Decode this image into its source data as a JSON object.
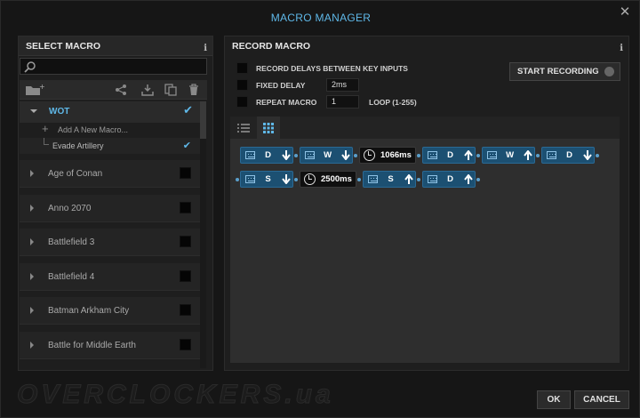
{
  "window": {
    "title": "MACRO MANAGER",
    "close_icon": "close-icon"
  },
  "select_panel": {
    "header": "SELECT MACRO",
    "info": "i",
    "search": {
      "value": "",
      "placeholder": ""
    },
    "toolbar_icons": [
      "new-folder-icon",
      "share-icon",
      "import-icon",
      "duplicate-icon",
      "trash-icon"
    ],
    "active_group": {
      "label": "WOT",
      "checked": true,
      "add_label": "Add A New Macro...",
      "macros": [
        {
          "label": "Evade Artillery",
          "checked": true
        }
      ]
    },
    "groups": [
      {
        "label": "Age of Conan"
      },
      {
        "label": "Anno 2070"
      },
      {
        "label": "Battlefield 3"
      },
      {
        "label": "Battlefield 4"
      },
      {
        "label": "Batman Arkham City"
      },
      {
        "label": "Battle for Middle Earth"
      }
    ]
  },
  "record_panel": {
    "header": "RECORD MACRO",
    "info": "i",
    "options": {
      "record_delays": "RECORD DELAYS BETWEEN KEY INPUTS",
      "fixed_delay": "FIXED DELAY",
      "fixed_delay_value": "2ms",
      "repeat_macro": "REPEAT MACRO",
      "repeat_value": "1",
      "loop_label": "LOOP (1-255)"
    },
    "start_button": "START RECORDING",
    "tabs": [
      "list-view-icon",
      "grid-view-icon"
    ],
    "sequence": [
      {
        "kind": "key",
        "key": "D",
        "dir": "down"
      },
      {
        "kind": "key",
        "key": "W",
        "dir": "down"
      },
      {
        "kind": "delay",
        "text": "1066ms"
      },
      {
        "kind": "key",
        "key": "D",
        "dir": "up"
      },
      {
        "kind": "key",
        "key": "W",
        "dir": "up"
      },
      {
        "kind": "key",
        "key": "D",
        "dir": "down"
      },
      {
        "kind": "key",
        "key": "S",
        "dir": "down"
      },
      {
        "kind": "delay",
        "text": "2500ms"
      },
      {
        "kind": "key",
        "key": "S",
        "dir": "up"
      },
      {
        "kind": "key",
        "key": "D",
        "dir": "up"
      }
    ]
  },
  "footer": {
    "ok": "OK",
    "cancel": "CANCEL",
    "watermark": "OVERCLOCKERS.ua"
  },
  "colors": {
    "accent": "#5fb8e8",
    "node": "#1c5072"
  }
}
